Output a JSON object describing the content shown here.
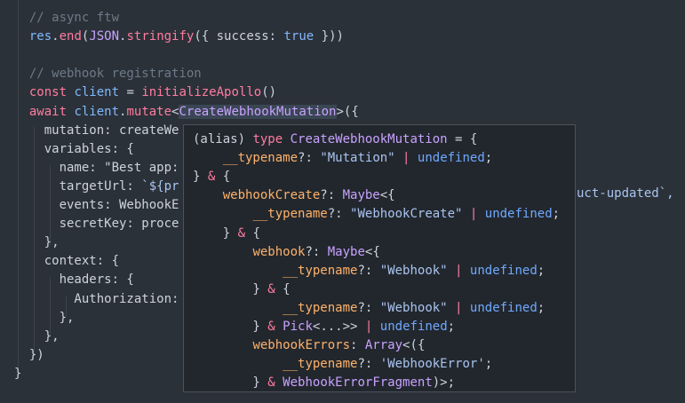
{
  "editor": {
    "lines": [
      {
        "t": "  // async ftw"
      },
      {
        "t": "  res.end(JSON.stringify({ success: true }))"
      },
      {
        "t": ""
      },
      {
        "t": "  // webhook registration"
      },
      {
        "t": "  const client = initializeApollo()"
      },
      {
        "t": "  await client.mutate<CreateWebhookMutation>({"
      },
      {
        "t": "    mutation: createWe"
      },
      {
        "t": "    variables: {"
      },
      {
        "t": "      name: \"Best app:"
      },
      {
        "t": "      targetUrl: `${pr"
      },
      {
        "t": "      events: WebhookE"
      },
      {
        "t": "      secretKey: proce"
      },
      {
        "t": "    },"
      },
      {
        "t": "    context: {"
      },
      {
        "t": "      headers: {"
      },
      {
        "t": "        Authorization:"
      },
      {
        "t": "      },"
      },
      {
        "t": "    },"
      },
      {
        "t": "  })"
      },
      {
        "t": "}"
      }
    ],
    "overflow_right_text": "uct-updated`,"
  },
  "tooltip": {
    "lines": [
      "(alias) type CreateWebhookMutation = {",
      "    __typename?: \"Mutation\" | undefined;",
      "} & {",
      "    webhookCreate?: Maybe<{",
      "        __typename?: \"WebhookCreate\" | undefined;",
      "    } & {",
      "        webhook?: Maybe<{",
      "            __typename?: \"Webhook\" | undefined;",
      "        } & {",
      "            __typename?: \"Webhook\" | undefined;",
      "        } & Pick<...>> | undefined;",
      "        webhookErrors: Array<({",
      "            __typename?: 'WebhookError';",
      "        } & WebhookErrorFragment)>;"
    ]
  },
  "colors": {
    "background": "#2b3138",
    "tooltip_background": "#22272d",
    "keyword": "#ff7ca0",
    "type": "#c8a2ff",
    "string": "#a9c4f0",
    "property": "#ffb26b",
    "comment": "#6d7a88"
  }
}
